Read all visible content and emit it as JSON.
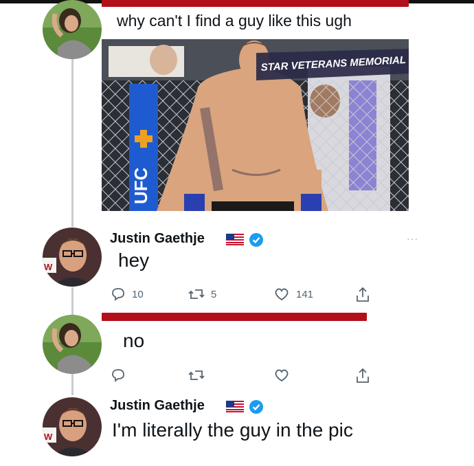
{
  "tweet1": {
    "text": "why can't I find a guy like this ugh"
  },
  "photo": {
    "banner_text": "STAR VETERANS MEMORIAL",
    "octagon_mark": "UFC"
  },
  "reply1": {
    "name": "Justin Gaethje",
    "text": "hey",
    "replies": "10",
    "retweets": "5",
    "likes": "141",
    "more": "···"
  },
  "tweet2": {
    "text": "no"
  },
  "reply2": {
    "name": "Justin Gaethje",
    "text": "I'm literally the guy in the pic"
  },
  "colors": {
    "redaction": "#b3101a",
    "verified": "#1d9bf0",
    "icon_gray": "#536471",
    "thread_line": "#c7ccd1"
  }
}
